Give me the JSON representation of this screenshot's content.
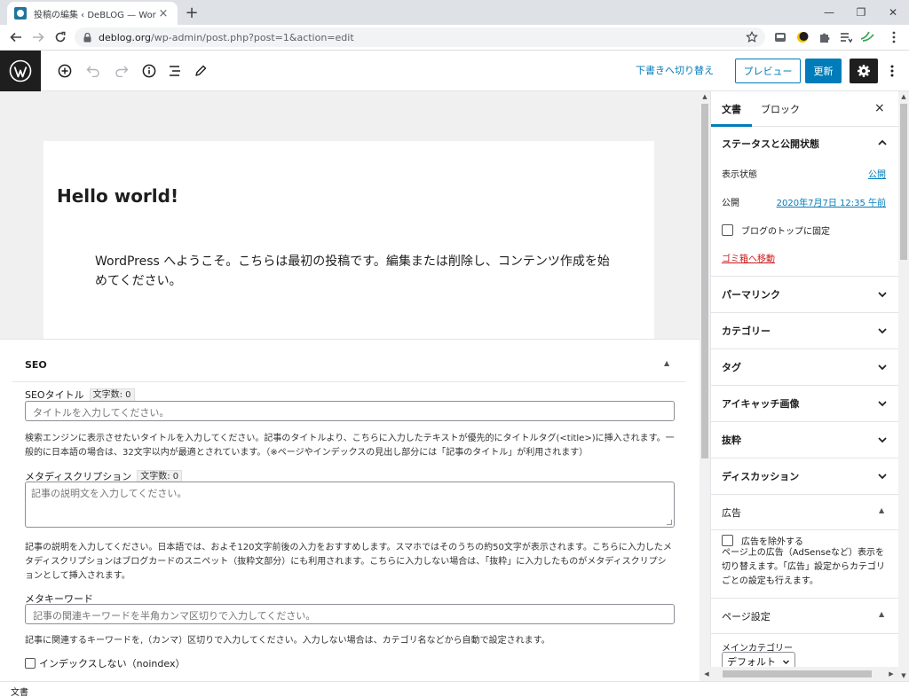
{
  "browser": {
    "tab_title": "投稿の編集 ‹ DeBLOG — WordPress",
    "tab_close": "×",
    "new_tab": "+",
    "window_controls": {
      "minimize": "—",
      "restore": "❐",
      "close": "✕"
    },
    "url_host": "deblog.org",
    "url_path": "/wp-admin/post.php?post=1&action=edit"
  },
  "header": {
    "switch_to_draft": "下書きへ切り替え",
    "preview": "プレビュー",
    "update": "更新"
  },
  "post": {
    "title": "Hello world!",
    "content": "WordPress へようこそ。こちらは最初の投稿です。編集または削除し、コンテンツ作成を始めてください。"
  },
  "seo": {
    "heading": "SEO",
    "toggle": "▲",
    "title_label": "SEOタイトル",
    "title_counter": "文字数: 0",
    "title_placeholder": "タイトルを入力してください。",
    "title_help": "検索エンジンに表示させたいタイトルを入力してください。記事のタイトルより、こちらに入力したテキストが優先的にタイトルタグ(<title>)に挿入されます。一般的に日本語の場合は、32文字以内が最適とされています。（※ページやインデックスの見出し部分には「記事のタイトル」が利用されます）",
    "desc_label": "メタディスクリプション",
    "desc_counter": "文字数: 0",
    "desc_placeholder": "記事の説明文を入力してください。",
    "desc_help": "記事の説明を入力してください。日本語では、およそ120文字前後の入力をおすすめします。スマホではそのうちの約50文字が表示されます。こちらに入力したメタディスクリプションはブログカードのスニペット（抜粋文部分）にも利用されます。こちらに入力しない場合は、「抜粋」に入力したものがメタディスクリプションとして挿入されます。",
    "keywords_label": "メタキーワード",
    "keywords_placeholder": "記事の関連キーワードを半角カンマ区切りで入力してください。",
    "keywords_help": "記事に関連するキーワードを,（カンマ）区切りで入力してください。入力しない場合は、カテゴリ名などから自動で設定されます。",
    "noindex_label": "インデックスしない（noindex）"
  },
  "sidebar": {
    "tab_document": "文書",
    "tab_block": "ブロック",
    "close": "×",
    "status_panel": {
      "title": "ステータスと公開状態",
      "visibility_label": "表示状態",
      "visibility_value": "公開",
      "publish_label": "公開",
      "publish_value": "2020年7月7日 12:35 午前",
      "sticky_label": "ブログのトップに固定",
      "trash": "ゴミ箱へ移動"
    },
    "panels": [
      "パーマリンク",
      "カテゴリー",
      "タグ",
      "アイキャッチ画像",
      "抜粋",
      "ディスカッション"
    ],
    "ad_panel": {
      "title": "広告",
      "exclude_label": "広告を除外する",
      "description": "ページ上の広告（AdSenseなど）表示を切り替えます。「広告」設定からカテゴリごとの設定も行えます。"
    },
    "page_settings": {
      "title": "ページ設定",
      "main_category_label": "メインカテゴリー",
      "main_category_value": "デフォルト"
    }
  },
  "breadcrumb": "文書",
  "colors": {
    "accent": "#007cba",
    "danger": "#cc1818",
    "dark": "#1e1e1e"
  }
}
